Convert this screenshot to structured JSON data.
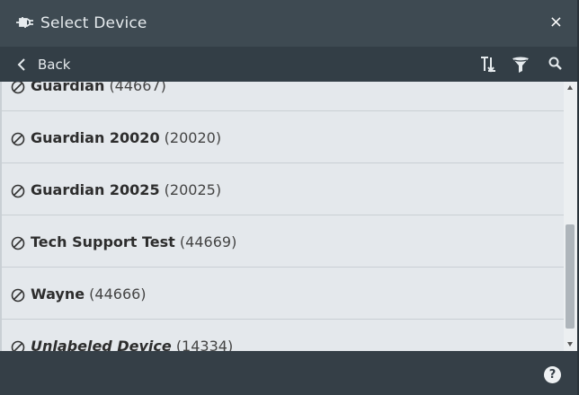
{
  "window": {
    "title": "Select Device",
    "icon": "plug-icon",
    "close_glyph": "×"
  },
  "nav": {
    "back_label": "Back",
    "tools": [
      "sort-icon",
      "filter-icon",
      "search-icon"
    ]
  },
  "devices": [
    {
      "name": "Guardian",
      "id": "(44667)",
      "italic": false
    },
    {
      "name": "Guardian 20020",
      "id": "(20020)",
      "italic": false
    },
    {
      "name": "Guardian 20025",
      "id": "(20025)",
      "italic": false
    },
    {
      "name": "Tech Support Test",
      "id": "(44669)",
      "italic": false
    },
    {
      "name": "Wayne",
      "id": "(44666)",
      "italic": false
    },
    {
      "name": "Unlabeled Device",
      "id": "(14334)",
      "italic": true
    }
  ],
  "footer": {
    "help_glyph": "?"
  },
  "colors": {
    "titlebar": "#3e4a52",
    "navbar": "#333e46",
    "list_bg": "#e4e8ec",
    "footer": "#353f47"
  }
}
